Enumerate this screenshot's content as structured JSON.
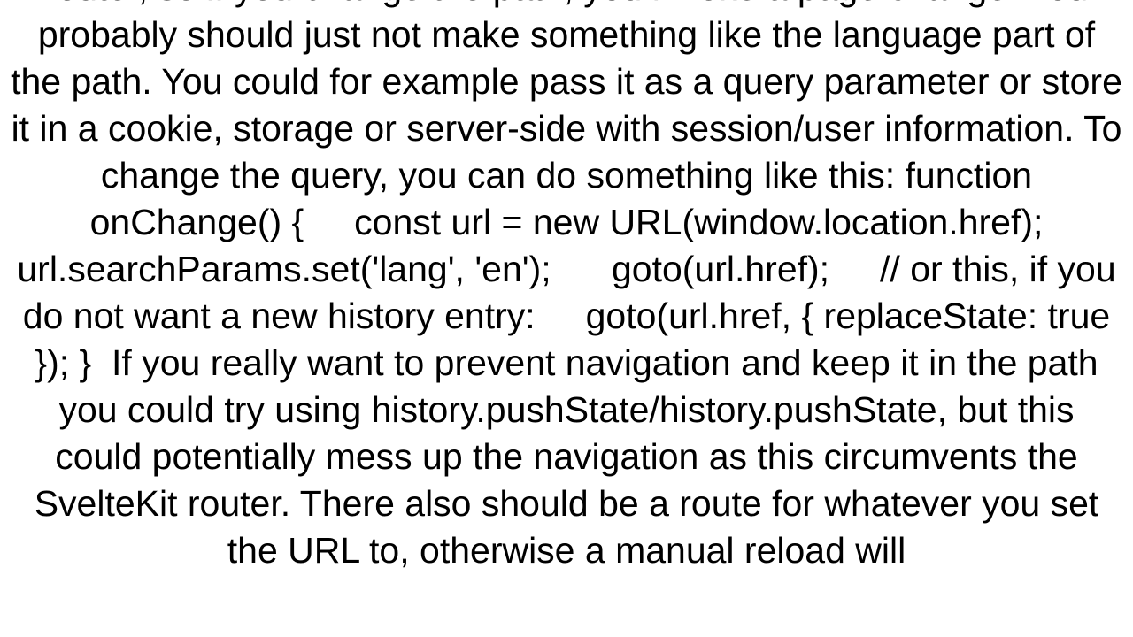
{
  "document": {
    "body_text": "router, so if you change the path, you invoke a page change. You probably should just not make something like the language part of the path. You could for example pass it as a query parameter or store it in a cookie, storage or server-side with session/user information. To change the query, you can do something like this: function onChange() {     const url = new URL(window.location.href);     url.searchParams.set('lang', 'en');      goto(url.href);     // or this, if you do not want a new history entry:     goto(url.href, { replaceState: true }); }  If you really want to prevent navigation and keep it in the path you could try using history.pushState/history.pushState, but this could potentially mess up the navigation as this circumvents the SvelteKit router. There also should be a route for whatever you set the URL to, otherwise a manual reload will"
  }
}
